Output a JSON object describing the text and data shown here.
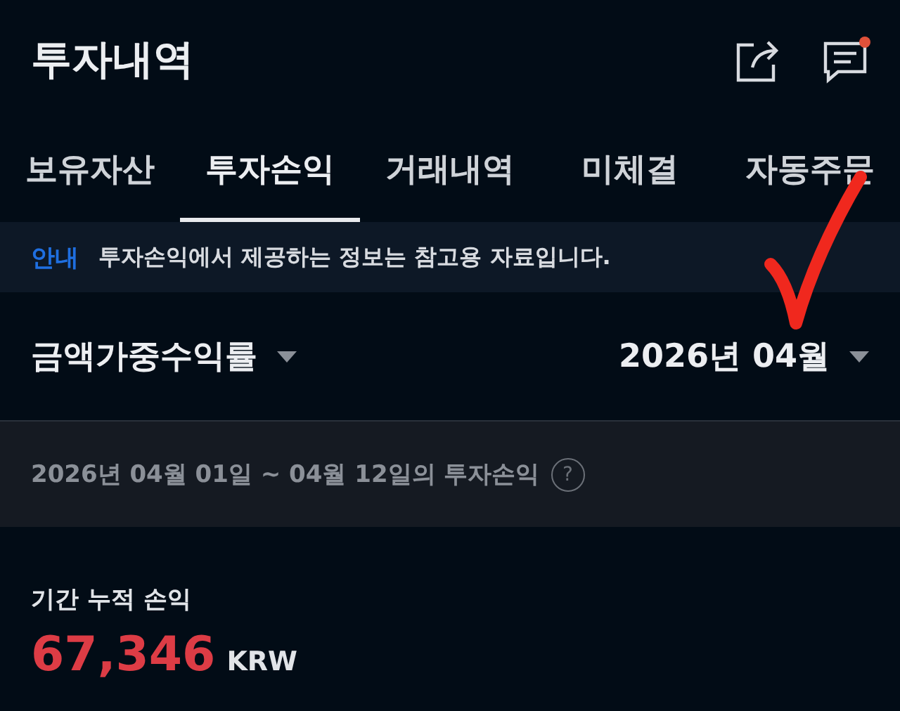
{
  "header": {
    "title": "투자내역",
    "notification_dot": true
  },
  "tabs": [
    {
      "label": "보유자산",
      "selected": false
    },
    {
      "label": "투자손익",
      "selected": true
    },
    {
      "label": "거래내역",
      "selected": false
    },
    {
      "label": "미체결",
      "selected": false
    },
    {
      "label": "자동주문",
      "selected": false
    }
  ],
  "notice": {
    "tag": "안내",
    "text": "투자손익에서 제공하는 정보는 참고용 자료입니다."
  },
  "filters": {
    "metric": "금액가중수익률",
    "month": "2026년 04월"
  },
  "period": {
    "text": "2026년 04월 01일 ~ 04월 12일의 투자손익",
    "help": "?"
  },
  "summary": {
    "label": "기간 누적 손익",
    "value": "67,346",
    "unit": "KRW"
  },
  "annotation": {
    "kind": "checkmark"
  }
}
